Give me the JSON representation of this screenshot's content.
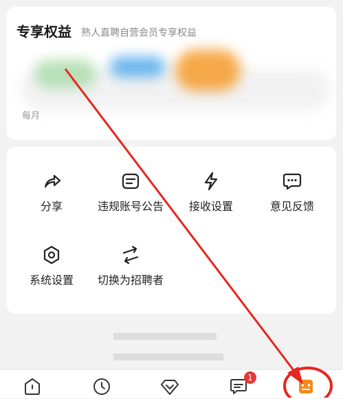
{
  "benefits": {
    "title": "专享权益",
    "subtitle": "熟人直聘自营会员专享权益",
    "footnote": "每月"
  },
  "tools": [
    {
      "label": "分享",
      "icon": "share-icon"
    },
    {
      "label": "违规账号公告",
      "icon": "notice-icon"
    },
    {
      "label": "接收设置",
      "icon": "lightning-icon"
    },
    {
      "label": "意见反馈",
      "icon": "feedback-icon"
    },
    {
      "label": "系统设置",
      "icon": "settings-hexagon-icon"
    },
    {
      "label": "切换为招聘者",
      "icon": "switch-arrows-icon"
    }
  ],
  "bottom_nav": {
    "items": [
      {
        "icon": "home-icon"
      },
      {
        "icon": "clock-icon"
      },
      {
        "icon": "diamond-icon"
      },
      {
        "icon": "message-icon",
        "badge": "1"
      },
      {
        "icon": "profile-icon",
        "selected": true
      }
    ]
  },
  "colors": {
    "accent": "#f28b1a",
    "annotation": "#e8251f",
    "badge": "#e53935"
  }
}
